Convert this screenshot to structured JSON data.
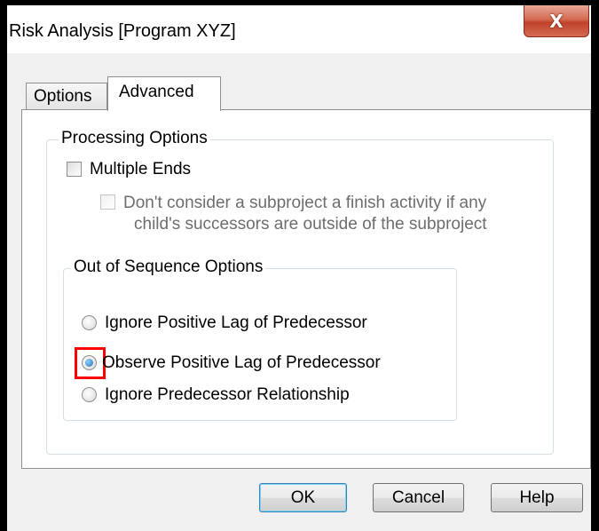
{
  "window": {
    "title": "Risk Analysis [Program XYZ]",
    "close_glyph": "X"
  },
  "tabs": [
    {
      "label": "Options",
      "active": false
    },
    {
      "label": "Advanced",
      "active": true
    }
  ],
  "processing": {
    "group_label": "Processing Options",
    "multiple_ends": {
      "label": "Multiple Ends",
      "checked": false
    },
    "subproject_option": {
      "line1": "Don't consider a subproject a finish activity if any",
      "line2": "child's successors are outside of the subproject",
      "checked": false,
      "enabled": false
    }
  },
  "out_of_sequence": {
    "group_label": "Out of Sequence Options",
    "options": [
      {
        "label": "Ignore Positive Lag of Predecessor",
        "selected": false
      },
      {
        "label": "Observe Positive Lag of Predecessor",
        "selected": true
      },
      {
        "label": "Ignore Predecessor Relationship",
        "selected": false
      }
    ]
  },
  "buttons": {
    "ok": "OK",
    "cancel": "Cancel",
    "help": "Help"
  },
  "colors": {
    "highlight": "#ff0000",
    "radio_selected": "#1e6fb8"
  }
}
